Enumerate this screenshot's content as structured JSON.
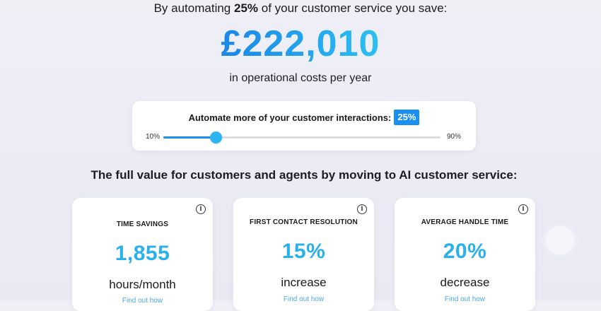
{
  "headline": {
    "prefix": "By automating ",
    "percent": "25%",
    "suffix": " of your customer service you save:"
  },
  "savings": {
    "amount": "£222,010",
    "caption": "in operational costs per year"
  },
  "slider": {
    "title": "Automate more of your customer interactions:",
    "value_label": "25%",
    "min_label": "10%",
    "max_label": "90%",
    "min": 10,
    "max": 90,
    "value": 25
  },
  "section_title": "The full value for customers and agents by moving to AI customer service:",
  "cards": [
    {
      "label": "TIME SAVINGS",
      "value": "1,855",
      "desc": "hours/month",
      "link": "Find out how"
    },
    {
      "label": "FIRST CONTACT RESOLUTION",
      "value": "15%",
      "desc": "increase",
      "link": "Find out how"
    },
    {
      "label": "AVERAGE HANDLE TIME",
      "value": "20%",
      "desc": "decrease",
      "link": "Find out how"
    }
  ],
  "icons": {
    "info": "info-icon",
    "info_glyph": "i",
    "chat": "chat-bubble-icon"
  },
  "colors": {
    "accent": "#1a8ff0",
    "value": "#2bb0ee"
  }
}
